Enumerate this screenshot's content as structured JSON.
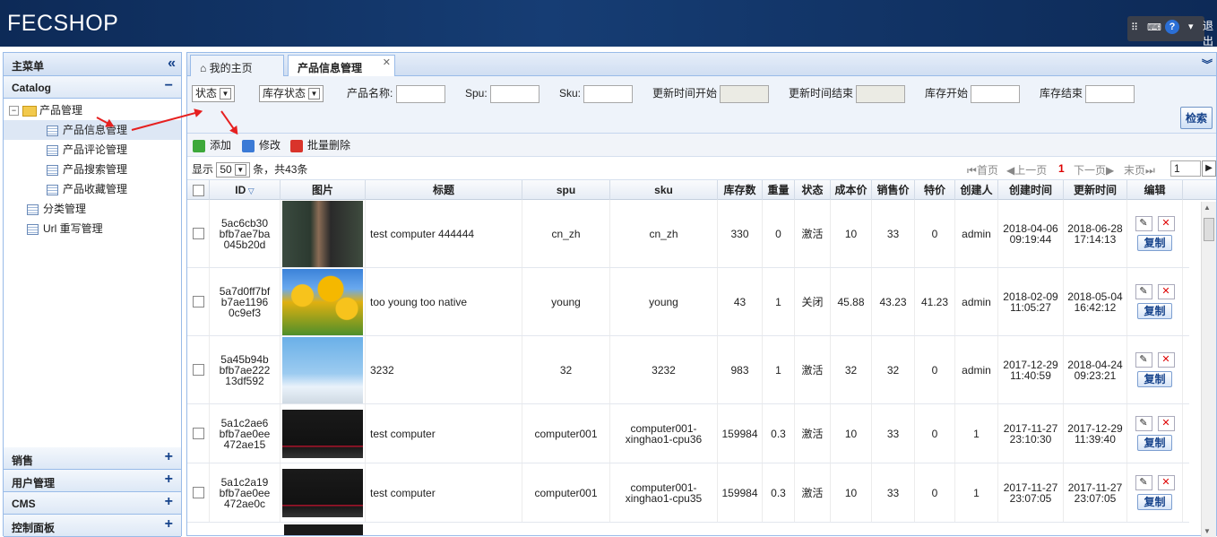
{
  "header": {
    "logo": "FECSHOP",
    "logout": "退出"
  },
  "sidebar": {
    "title": "主菜单",
    "catalog": "Catalog",
    "tree": {
      "root": "产品管理",
      "children": [
        "产品信息管理",
        "产品评论管理",
        "产品搜索管理",
        "产品收藏管理"
      ],
      "others": [
        "分类管理",
        "Url 重写管理"
      ]
    },
    "accordions": [
      "销售",
      "用户管理",
      "CMS",
      "控制面板"
    ]
  },
  "tabs": {
    "home": "我的主页",
    "active": "产品信息管理"
  },
  "filters": {
    "status": "状态",
    "stock_status": "库存状态",
    "product_name": "产品名称:",
    "spu": "Spu:",
    "sku": "Sku:",
    "updated_start": "更新时间开始",
    "updated_end": "更新时间结束",
    "stock_start": "库存开始",
    "stock_end": "库存结束",
    "search": "检索"
  },
  "toolbar": {
    "add": "添加",
    "edit": "修改",
    "batch_delete": "批量删除"
  },
  "pager": {
    "show": "显示",
    "page_size": "50",
    "total": "条，共43条",
    "first": "首页",
    "prev": "上一页",
    "current": "1",
    "next": "下一页",
    "last": "末页",
    "goto": "1"
  },
  "columns": [
    "ID",
    "图片",
    "标题",
    "spu",
    "sku",
    "库存数",
    "重量",
    "状态",
    "成本价",
    "销售价",
    "特价",
    "创建人",
    "创建时间",
    "更新时间",
    "编辑"
  ],
  "copy_label": "复制",
  "rows": [
    {
      "id": [
        "5ac6cb30",
        "bfb7ae7ba",
        "045b20d"
      ],
      "title": "test computer 444444",
      "spu": "cn_zh",
      "sku": [
        "cn_zh"
      ],
      "qty": "330",
      "weight": "0",
      "status": "激活",
      "cost": "10",
      "price": "33",
      "special": "0",
      "creator": "admin",
      "created": [
        "2018-04-06",
        "09:19:44"
      ],
      "updated": [
        "2018-06-28",
        "17:14:13"
      ],
      "img": "teacher"
    },
    {
      "id": [
        "5a7d0ff7bf",
        "b7ae1196",
        "0c9ef3"
      ],
      "title": "too young too native",
      "spu": "young",
      "sku": [
        "young"
      ],
      "qty": "43",
      "weight": "1",
      "status": "关闭",
      "cost": "45.88",
      "price": "43.23",
      "special": "41.23",
      "creator": "admin",
      "created": [
        "2018-02-09",
        "11:05:27"
      ],
      "updated": [
        "2018-05-04",
        "16:42:12"
      ],
      "img": "tulips"
    },
    {
      "id": [
        "5a45b94b",
        "bfb7ae222",
        "13df592"
      ],
      "title": "3232",
      "spu": "32",
      "sku": [
        "3232"
      ],
      "qty": "983",
      "weight": "1",
      "status": "激活",
      "cost": "32",
      "price": "32",
      "special": "0",
      "creator": "admin",
      "created": [
        "2017-12-29",
        "11:40:59"
      ],
      "updated": [
        "2018-04-24",
        "09:23:21"
      ],
      "img": "penguins"
    },
    {
      "id": [
        "5a1c2ae6",
        "bfb7ae0ee",
        "472ae15"
      ],
      "title": "test computer",
      "spu": "computer001",
      "sku": [
        "computer001-",
        "xinghao1-cpu36"
      ],
      "qty": "159984",
      "weight": "0.3",
      "status": "激活",
      "cost": "10",
      "price": "33",
      "special": "0",
      "creator": "1",
      "created": [
        "2017-11-27",
        "23:10:30"
      ],
      "updated": [
        "2017-12-29",
        "11:39:40"
      ],
      "img": "laptop"
    },
    {
      "id": [
        "5a1c2a19",
        "bfb7ae0ee",
        "472ae0c"
      ],
      "title": "test computer",
      "spu": "computer001",
      "sku": [
        "computer001-",
        "xinghao1-cpu35"
      ],
      "qty": "159984",
      "weight": "0.3",
      "status": "激活",
      "cost": "10",
      "price": "33",
      "special": "0",
      "creator": "1",
      "created": [
        "2017-11-27",
        "23:07:05"
      ],
      "updated": [
        "2017-11-27",
        "23:07:05"
      ],
      "img": "laptop"
    }
  ]
}
